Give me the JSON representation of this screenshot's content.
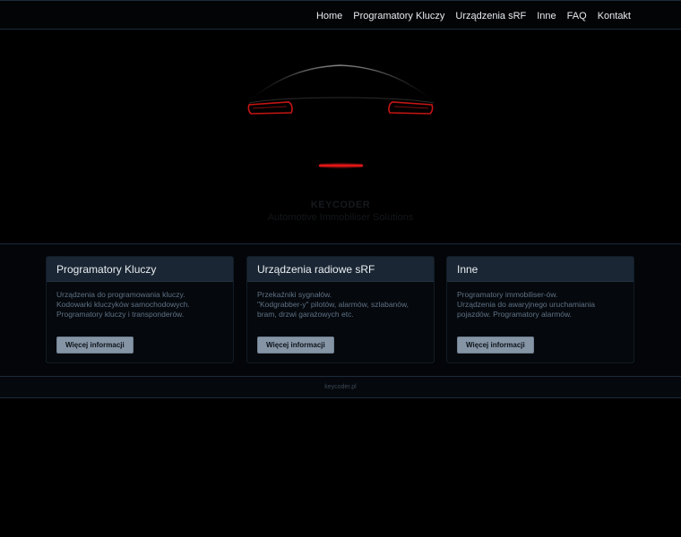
{
  "nav": {
    "items": [
      {
        "label": "Home"
      },
      {
        "label": "Programatory Kluczy"
      },
      {
        "label": "Urządzenia sRF"
      },
      {
        "label": "Inne"
      },
      {
        "label": "FAQ"
      },
      {
        "label": "Kontakt"
      }
    ]
  },
  "hero": {
    "title": "KEYCODER",
    "subtitle": "Automotive Immobiliser Solutions",
    "image": "car-rear-silhouette-icon",
    "accent_color": "#d01818"
  },
  "cards": [
    {
      "title": "Programatory Kluczy",
      "lines": [
        "Urządzenia do programowania kluczy.",
        "Kodowarki kluczyków samochodowych.",
        "Programatory kluczy i transponderów."
      ],
      "button": "Więcej informacji"
    },
    {
      "title": "Urządzenia radiowe sRF",
      "lines": [
        "Przekaźniki sygnałów.",
        "\"Kodgrabber-y\" pilotów, alarmów, szlabanów,",
        "bram, drzwi garażowych etc."
      ],
      "button": "Więcej informacji"
    },
    {
      "title": "Inne",
      "lines": [
        "Programatory immobiliser-ów.",
        "Urządzenia do awaryjnego uruchamiania",
        "pojazdów. Programatory alarmów."
      ],
      "button": "Więcej informacji"
    }
  ],
  "footer": {
    "text": "keycoder.pl"
  }
}
